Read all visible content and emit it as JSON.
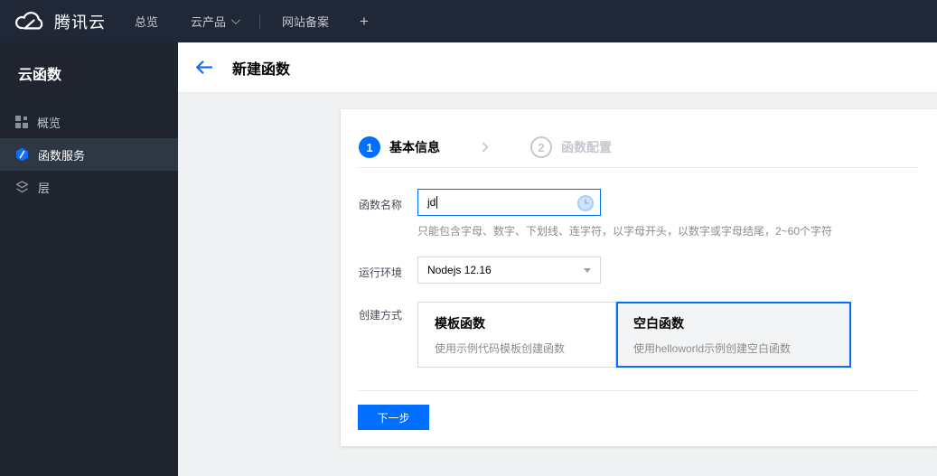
{
  "topnav": {
    "brand": "腾讯云",
    "overview": "总览",
    "products": "云产品",
    "icp": "网站备案",
    "plus": "+"
  },
  "sidebar": {
    "title": "云函数",
    "items": [
      {
        "label": "概览",
        "icon": "grid-icon",
        "selected": false
      },
      {
        "label": "函数服务",
        "icon": "function-service-icon",
        "selected": true
      },
      {
        "label": "层",
        "icon": "layers-icon",
        "selected": false
      }
    ]
  },
  "header": {
    "title": "新建函数"
  },
  "wizard": {
    "steps": [
      {
        "number": "1",
        "label": "基本信息",
        "state": "active"
      },
      {
        "number": "2",
        "label": "函数配置",
        "state": "inactive"
      }
    ]
  },
  "form": {
    "name": {
      "label": "函数名称",
      "value": "jd",
      "hint": "只能包含字母、数字、下划线、连字符，以字母开头，以数字或字母结尾，2~60个字符",
      "status_icon": "clock-pending-icon"
    },
    "runtime": {
      "label": "运行环境",
      "value": "Nodejs 12.16"
    },
    "method": {
      "label": "创建方式",
      "options": [
        {
          "title": "模板函数",
          "desc": "使用示例代码模板创建函数",
          "selected": false
        },
        {
          "title": "空白函数",
          "desc": "使用helloworld示例创建空白函数",
          "selected": true
        }
      ]
    }
  },
  "actions": {
    "next": "下一步"
  },
  "colors": {
    "accent": "#006eff",
    "topnav_bg": "#202837",
    "sidebar_bg": "#1f242e",
    "sidebar_selected_bg": "#2e3845",
    "content_bg": "#f0f1f2",
    "inactive_step": "#c4c8ce"
  }
}
